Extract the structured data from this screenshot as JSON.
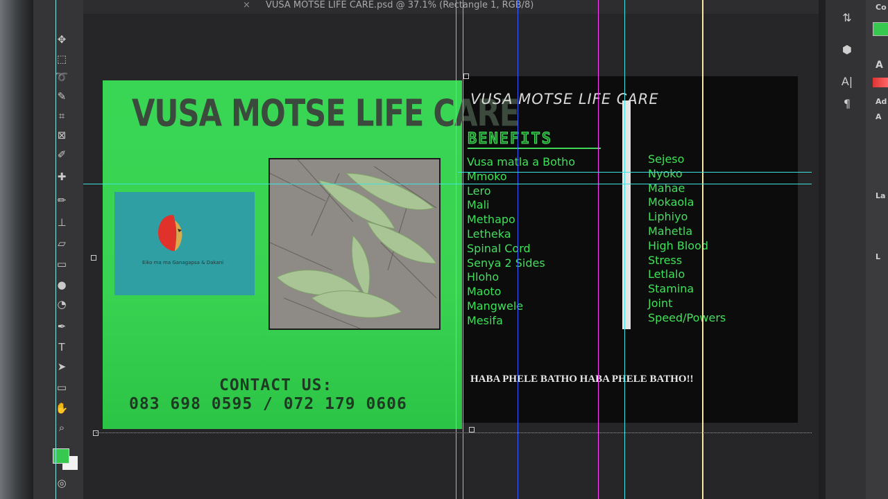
{
  "window": {
    "title": "VUSA MOTSE LIFE CARE.psd @ 37.1% (Rectangle 1, RGB/8)",
    "close_glyph": "×"
  },
  "toolbar": {
    "tools": [
      "move-icon",
      "lasso-icon",
      "crop-icon",
      "eyedropper-icon",
      "healing-icon",
      "brush-icon",
      "stamp-icon",
      "history-brush-icon",
      "eraser-icon",
      "gradient-icon",
      "blur-icon",
      "dodge-icon",
      "pen-icon",
      "type-icon",
      "path-select-icon",
      "rectangle-icon",
      "hand-icon",
      "zoom-icon"
    ],
    "type_glyph": "T"
  },
  "right_panel": {
    "icons": [
      "properties-icon",
      "3d-icon",
      "character-icon",
      "paragraph-icon"
    ],
    "character_glyph": "A|",
    "paragraph_glyph": "¶",
    "labels": [
      "Co",
      "A",
      "Ad",
      "A",
      "La",
      "L"
    ]
  },
  "design": {
    "brand_title": "VUSA MOTSE LIFE CARE",
    "logo_caption": "Eiko ma ma Ganagapsa & Dakani",
    "contact_title": "CONTACT US:",
    "contact_phone": "083 698 0595 / 072 179 0606",
    "right_title": "VUSA MOTSE LIFE CARE",
    "benefits_heading": "BENEFITS",
    "benefits_col1": [
      "Vusa matla a Botho",
      "Mmoko",
      "Lero",
      "Mali",
      "Methapo",
      "Letheka",
      "Spinal Cord",
      "Senya 2 Sides",
      "Hloho",
      "Maoto",
      "Mangwele",
      "Mesifa"
    ],
    "benefits_col2": [
      "Sejeso",
      "Nyoko",
      "Mahae",
      "Mokaola",
      "Liphiyo",
      "Mahetla",
      "High Blood",
      "Stress",
      "Letlalo",
      "Stamina",
      "Joint",
      "Speed/Powers"
    ],
    "slogan": "HABA PHELE BATHO HABA PHELE BATHO!!"
  },
  "colors": {
    "design_green": "#3ad251",
    "list_green": "#41e05a",
    "guide_cyan": "#3fe3e0",
    "guide_blue": "#3b5cff",
    "guide_magenta": "#ff3cff",
    "guide_yellow": "#f7e9a0"
  }
}
